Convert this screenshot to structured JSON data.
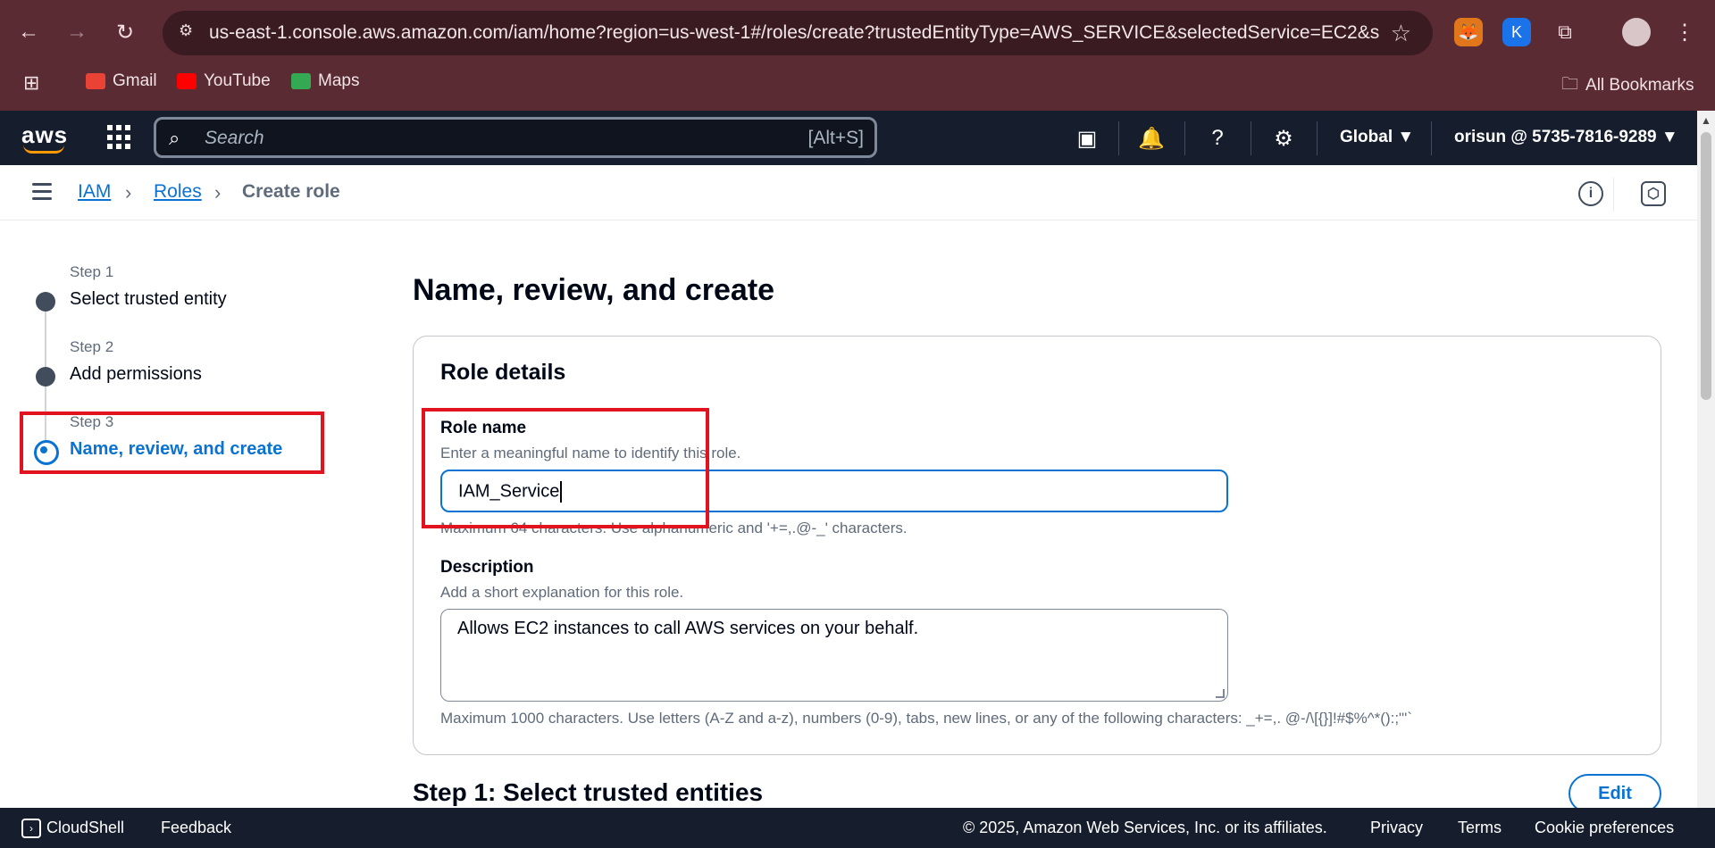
{
  "browser": {
    "url": "us-east-1.console.aws.amazon.com/iam/home?region=us-west-1#/roles/create?trustedEntityType=AWS_SERVICE&selectedService=EC2&s...",
    "bookmarks": [
      "Gmail",
      "YouTube",
      "Maps"
    ],
    "all_bookmarks": "All Bookmarks",
    "ext_k_letter": "K"
  },
  "aws_nav": {
    "logo": "aws",
    "search_placeholder": "Search",
    "search_shortcut": "[Alt+S]",
    "region": "Global",
    "account": "orisun @ 5735-7816-9289"
  },
  "breadcrumb": {
    "items": [
      "IAM",
      "Roles"
    ],
    "current": "Create role"
  },
  "steps": [
    {
      "label": "Step 1",
      "title": "Select trusted entity"
    },
    {
      "label": "Step 2",
      "title": "Add permissions"
    },
    {
      "label": "Step 3",
      "title": "Name, review, and create"
    }
  ],
  "main": {
    "title": "Name, review, and create",
    "panel_title": "Role details",
    "role_name": {
      "label": "Role name",
      "description": "Enter a meaningful name to identify this role.",
      "value": "IAM_Service",
      "constraint": "Maximum 64 characters. Use alphanumeric and '+=,.@-_' characters."
    },
    "description_field": {
      "label": "Description",
      "description": "Add a short explanation for this role.",
      "value": "Allows EC2 instances to call AWS services on your behalf.",
      "constraint": "Maximum 1000 characters. Use letters (A-Z and a-z), numbers (0-9), tabs, new lines, or any of the following characters: _+=,. @-/\\[{}]!#$%^*():;\"'`"
    },
    "section_title": "Step 1: Select trusted entities",
    "edit_label": "Edit"
  },
  "footer": {
    "cloudshell": "CloudShell",
    "feedback": "Feedback",
    "copyright": "© 2025, Amazon Web Services, Inc. or its affiliates.",
    "privacy": "Privacy",
    "terms": "Terms",
    "cookies": "Cookie preferences"
  }
}
